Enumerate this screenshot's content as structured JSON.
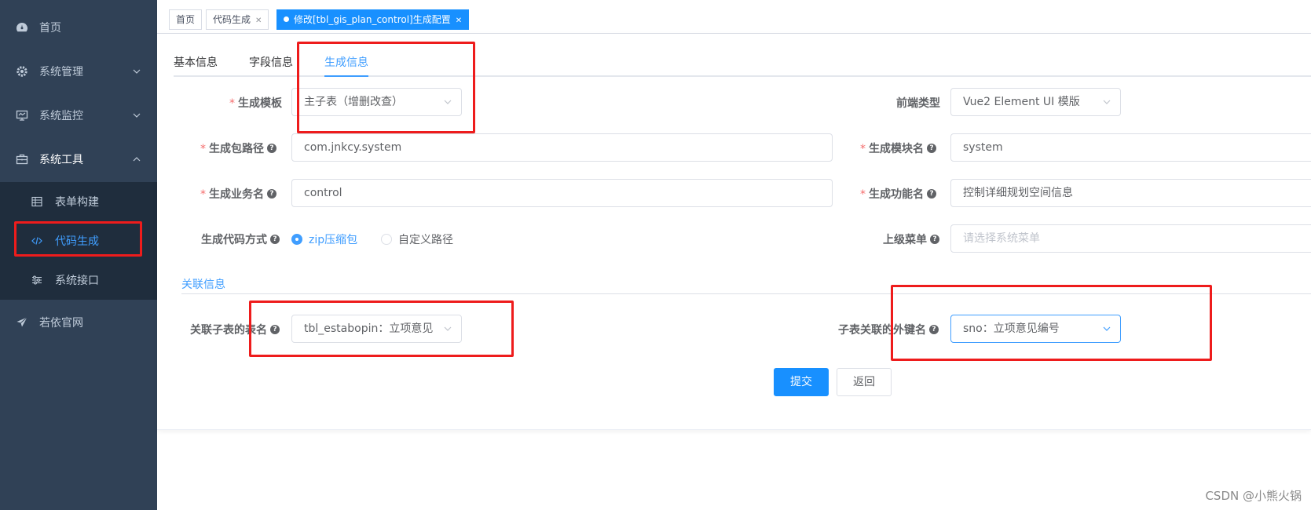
{
  "sidebar": {
    "items": [
      {
        "label": "首页",
        "icon": "dashboard-icon"
      },
      {
        "label": "系统管理",
        "icon": "gear-icon"
      },
      {
        "label": "系统监控",
        "icon": "monitor-icon"
      },
      {
        "label": "系统工具",
        "icon": "toolbox-icon"
      },
      {
        "label": "若依官网",
        "icon": "send-icon"
      }
    ],
    "sub_items": [
      {
        "label": "表单构建",
        "icon": "table-icon"
      },
      {
        "label": "代码生成",
        "icon": "code-icon"
      },
      {
        "label": "系统接口",
        "icon": "sliders-icon"
      }
    ]
  },
  "tags": [
    {
      "label": "首页"
    },
    {
      "label": "代码生成"
    },
    {
      "label": "修改[tbl_gis_plan_control]生成配置"
    }
  ],
  "tabs": [
    {
      "label": "基本信息"
    },
    {
      "label": "字段信息"
    },
    {
      "label": "生成信息"
    }
  ],
  "form": {
    "tpl_category": {
      "label": "生成模板",
      "value": "主子表（增删改查）"
    },
    "frontend_type": {
      "label": "前端类型",
      "value": "Vue2 Element UI 模版"
    },
    "package_name": {
      "label": "生成包路径",
      "value": "com.jnkcy.system"
    },
    "module_name": {
      "label": "生成模块名",
      "value": "system"
    },
    "business_name": {
      "label": "生成业务名",
      "value": "control"
    },
    "function_name": {
      "label": "生成功能名",
      "value": "控制详细规划空间信息"
    },
    "gen_type": {
      "label": "生成代码方式",
      "option_zip": "zip压缩包",
      "option_custom": "自定义路径",
      "selected": "zip压缩包"
    },
    "parent_menu": {
      "label": "上级菜单",
      "placeholder": "请选择系统菜单"
    },
    "relation_title": "关联信息",
    "sub_table": {
      "label": "关联子表的表名",
      "value": "tbl_estabopin：立项意见"
    },
    "sub_fk": {
      "label": "子表关联的外键名",
      "value": "sno：立项意见编号"
    }
  },
  "buttons": {
    "submit": "提交",
    "back": "返回"
  },
  "watermark": "CSDN @小熊火锅",
  "colors": {
    "sidebar": "#304156",
    "submenu": "#1f2d3d",
    "primary": "#1890ff",
    "highlight": "#ee1c1c"
  }
}
